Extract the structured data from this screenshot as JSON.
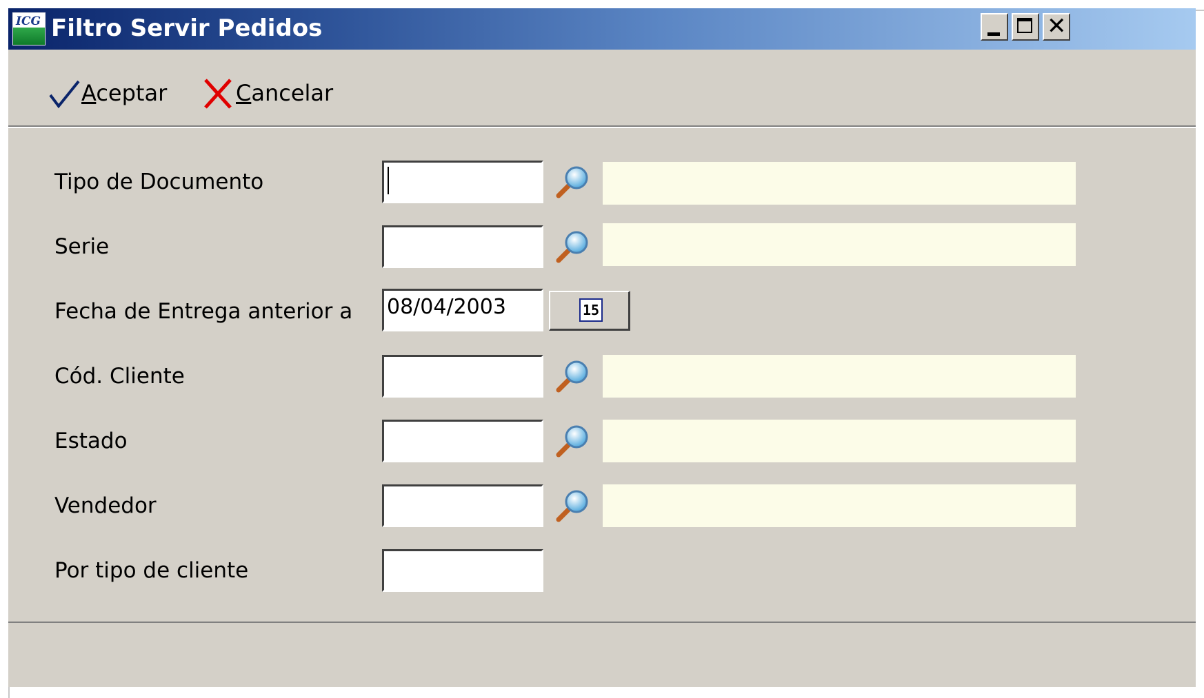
{
  "window": {
    "title": "Filtro Servir Pedidos",
    "app_icon_text": "ICG",
    "controls": {
      "minimize": "minimize",
      "maximize": "maximize",
      "close": "✕"
    }
  },
  "toolbar": {
    "accept": {
      "accel": "A",
      "rest": "ceptar",
      "icon": "checkmark-icon",
      "color": "#0a246a"
    },
    "cancel": {
      "accel": "C",
      "rest": "ancelar",
      "icon": "red-x-icon",
      "color": "#e00000"
    }
  },
  "fields": [
    {
      "label": "Tipo de Documento",
      "value": "",
      "has_lookup": true,
      "has_focus": true
    },
    {
      "label": "Serie",
      "value": "",
      "has_lookup": true
    },
    {
      "label": "Fecha de Entrega anterior a",
      "value": "08/04/2003",
      "has_calendar": true,
      "calendar_day": "15"
    },
    {
      "label": "Cód. Cliente",
      "value": "",
      "has_lookup": true
    },
    {
      "label": "Estado",
      "value": "",
      "has_lookup": true
    },
    {
      "label": "Vendedor",
      "value": "",
      "has_lookup": true
    },
    {
      "label": "Por tipo de cliente",
      "value": ""
    }
  ],
  "colors": {
    "titlebar_start": "#0a246a",
    "titlebar_end": "#a6caf0",
    "face": "#d4d0c8",
    "description_box": "#fcfce8"
  }
}
